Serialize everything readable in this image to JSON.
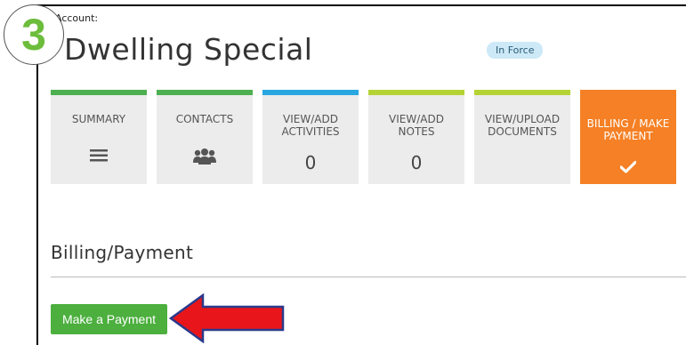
{
  "step_number": "3",
  "account": {
    "label": "Account:",
    "title": "Dwelling Special",
    "status": "In Force"
  },
  "tiles": [
    {
      "label": "SUMMARY",
      "value": "",
      "icon": "list-icon",
      "bar_color": "#4caf50"
    },
    {
      "label": "CONTACTS",
      "value": "",
      "icon": "users-icon",
      "bar_color": "#4caf50"
    },
    {
      "label": "VIEW/ADD ACTIVITIES",
      "value": "0",
      "icon": "",
      "bar_color": "#29a7e1"
    },
    {
      "label": "VIEW/ADD NOTES",
      "value": "0",
      "icon": "",
      "bar_color": "#b5d334"
    },
    {
      "label": "VIEW/UPLOAD DOCUMENTS",
      "value": "",
      "icon": "",
      "bar_color": "#b5d334"
    },
    {
      "label": "BILLING / MAKE PAYMENT",
      "value": "",
      "icon": "checkmark-icon",
      "bar_color": "#f58025",
      "active": true
    }
  ],
  "section": {
    "title": "Billing/Payment"
  },
  "make_payment_button": "Make a Payment",
  "colors": {
    "accent_orange": "#f58025",
    "button_green": "#4caf3e",
    "arrow_red": "#e8161a",
    "step_green": "#6cbd3c"
  }
}
